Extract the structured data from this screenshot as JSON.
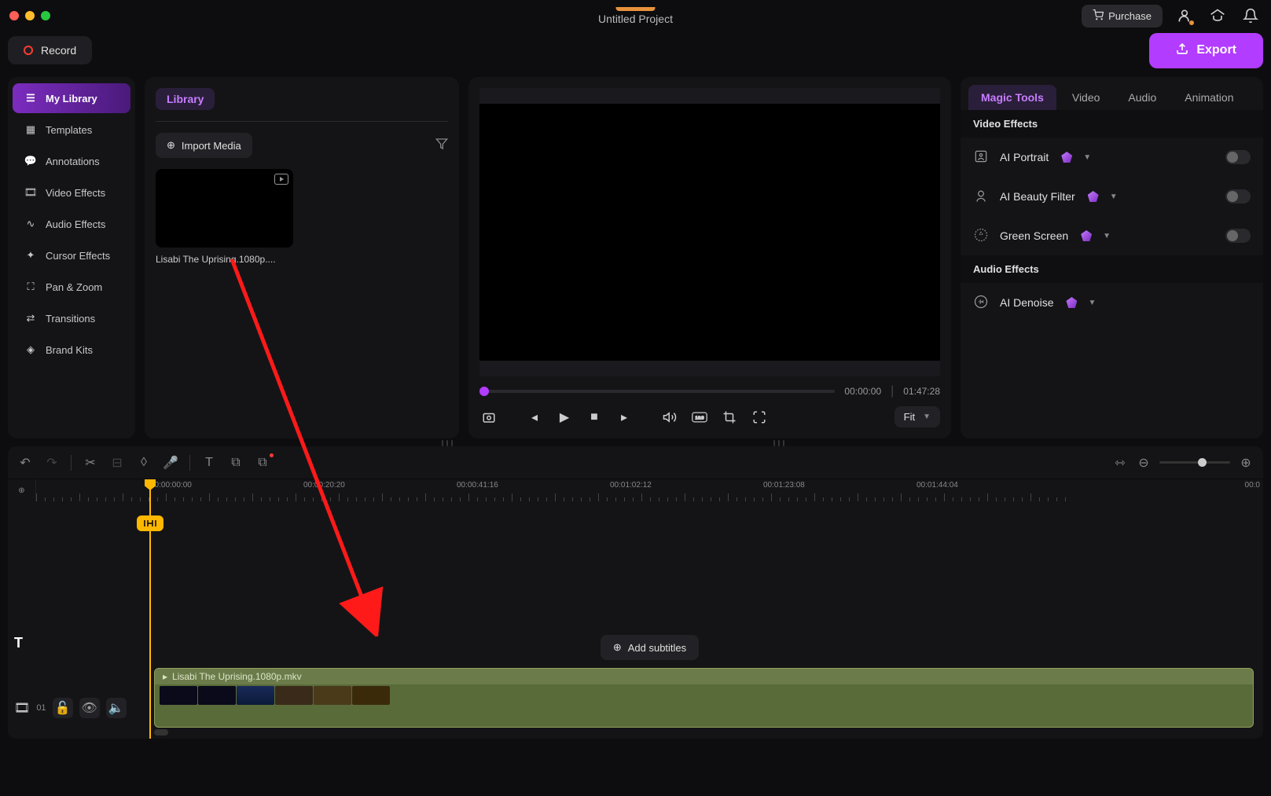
{
  "titlebar": {
    "project_name": "Untitled Project",
    "purchase_label": "Purchase"
  },
  "toolbar": {
    "record_label": "Record",
    "export_label": "Export"
  },
  "sidebar": {
    "items": [
      {
        "label": "My Library",
        "icon": "layers"
      },
      {
        "label": "Templates",
        "icon": "grid"
      },
      {
        "label": "Annotations",
        "icon": "message"
      },
      {
        "label": "Video Effects",
        "icon": "film"
      },
      {
        "label": "Audio Effects",
        "icon": "wave"
      },
      {
        "label": "Cursor Effects",
        "icon": "cursor"
      },
      {
        "label": "Pan & Zoom",
        "icon": "expand"
      },
      {
        "label": "Transitions",
        "icon": "arrows"
      },
      {
        "label": "Brand Kits",
        "icon": "badge"
      }
    ]
  },
  "library": {
    "tab_label": "Library",
    "import_label": "Import Media",
    "media": [
      {
        "name": "Lisabi The Uprising.1080p...."
      }
    ]
  },
  "preview": {
    "current_time": "00:00:00",
    "total_time": "01:47:28",
    "fit_label": "Fit"
  },
  "properties": {
    "tabs": [
      "Magic Tools",
      "Video",
      "Audio",
      "Animation"
    ],
    "sections": {
      "video_effects_hdr": "Video Effects",
      "audio_effects_hdr": "Audio Effects"
    },
    "effects": {
      "ai_portrait": "AI Portrait",
      "ai_beauty": "AI Beauty Filter",
      "green_screen": "Green Screen",
      "ai_denoise": "AI Denoise"
    }
  },
  "timeline": {
    "ruler": [
      "00:00:00:00",
      "00:00:20:20",
      "00:00:41:16",
      "00:01:02:12",
      "00:01:23:08",
      "00:01:44:04",
      "00:0"
    ],
    "add_subtitles_label": "Add subtitles",
    "track_number": "01",
    "clip_name": "Lisabi The Uprising.1080p.mkv"
  }
}
